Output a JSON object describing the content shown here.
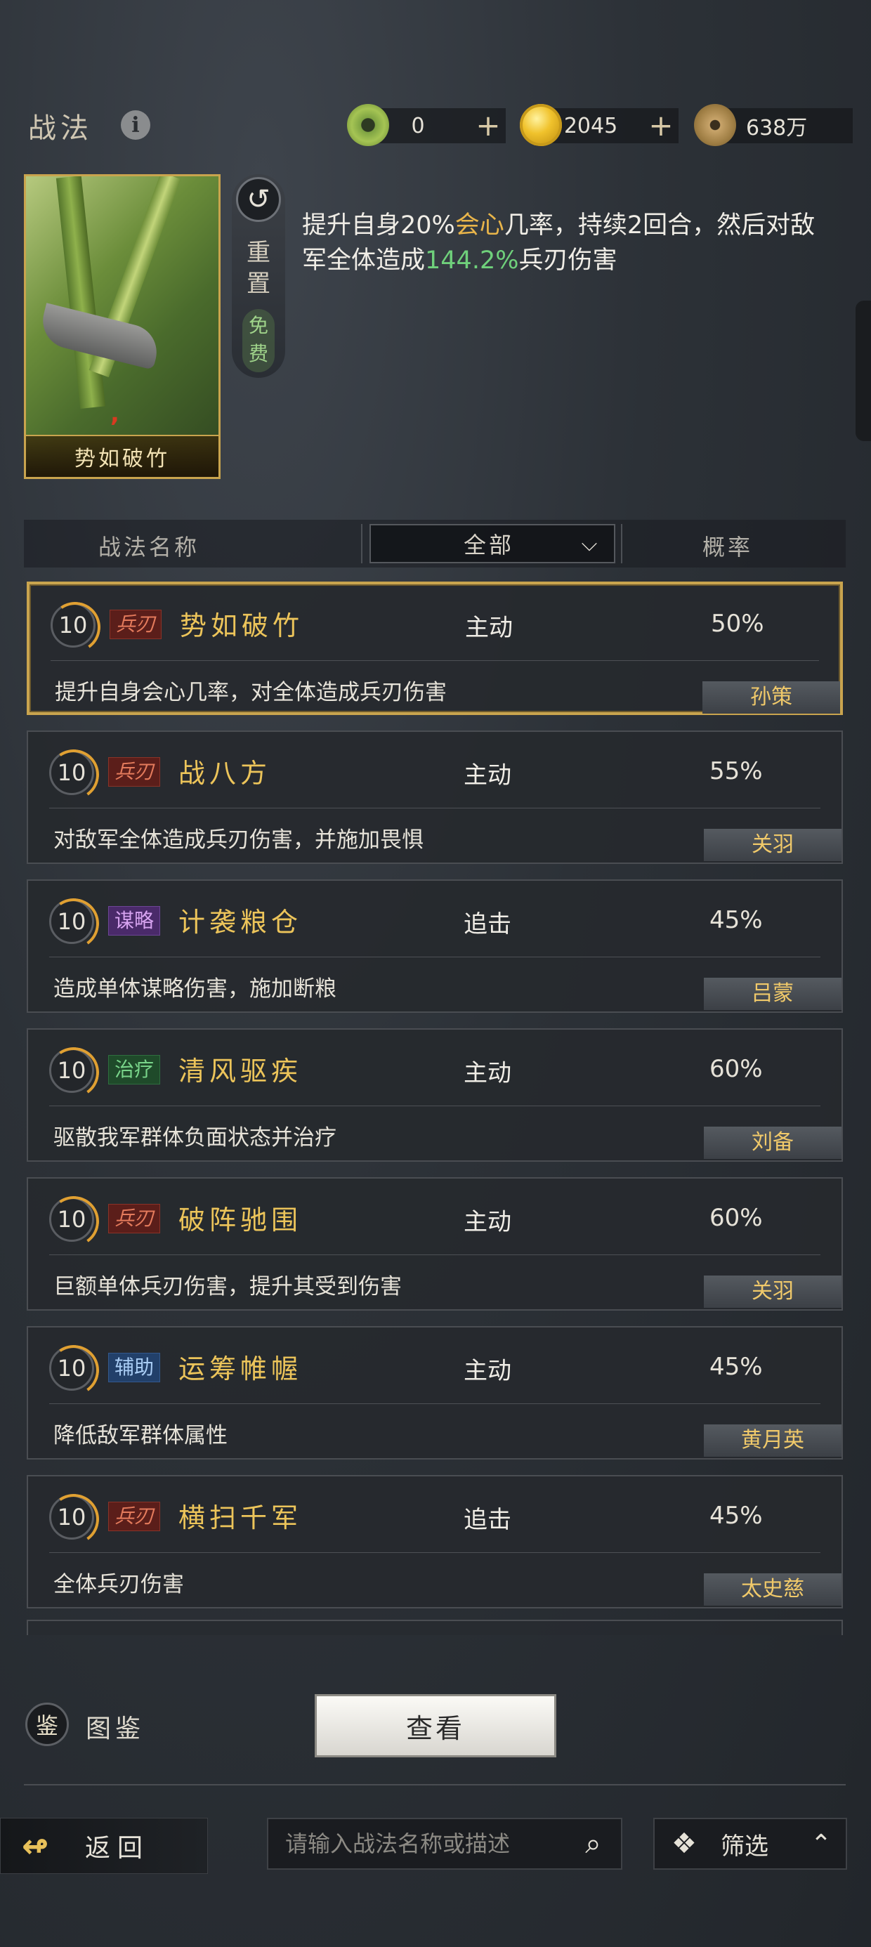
{
  "header": {
    "title": "战法",
    "info_icon": "i",
    "resources": [
      {
        "name": "jade",
        "value": "0",
        "plus": "+"
      },
      {
        "name": "gold",
        "value": "2045",
        "plus": "+"
      },
      {
        "name": "copper",
        "value": "638万"
      }
    ]
  },
  "featured": {
    "card_name": "势如破竹",
    "reset_icon": "↺",
    "reset_label": "重置",
    "free_label": "免费",
    "desc_part1": "提升自身20%",
    "desc_hl1": "会心",
    "desc_part2": "几率，持续2回合，然后对敌军全体造成",
    "desc_hl2": "144.2%",
    "desc_part3": "兵刃伤害"
  },
  "filter": {
    "col_name": "战法名称",
    "dropdown_value": "全部",
    "col_prob": "概率"
  },
  "list": [
    {
      "level": "10",
      "tag": "兵刃",
      "name": "势如破竹",
      "type": "主动",
      "prob": "50%",
      "desc": "提升自身会心几率，对全体造成兵刃伤害",
      "hero": "孙策"
    },
    {
      "level": "10",
      "tag": "兵刃",
      "name": "战八方",
      "type": "主动",
      "prob": "55%",
      "desc": "对敌军全体造成兵刃伤害，并施加畏惧",
      "hero": "关羽"
    },
    {
      "level": "10",
      "tag": "谋略",
      "name": "计袭粮仓",
      "type": "追击",
      "prob": "45%",
      "desc": "造成单体谋略伤害，施加断粮",
      "hero": "吕蒙"
    },
    {
      "level": "10",
      "tag": "治疗",
      "name": "清风驱疾",
      "type": "主动",
      "prob": "60%",
      "desc": "驱散我军群体负面状态并治疗",
      "hero": "刘备"
    },
    {
      "level": "10",
      "tag": "兵刃",
      "name": "破阵驰围",
      "type": "主动",
      "prob": "60%",
      "desc": "巨额单体兵刃伤害，提升其受到伤害",
      "hero": "关羽"
    },
    {
      "level": "10",
      "tag": "辅助",
      "name": "运筹帷幄",
      "type": "主动",
      "prob": "45%",
      "desc": "降低敌军群体属性",
      "hero": "黄月英"
    },
    {
      "level": "10",
      "tag": "兵刃",
      "name": "横扫千军",
      "type": "追击",
      "prob": "45%",
      "desc": "全体兵刃伤害",
      "hero": "太史慈"
    }
  ],
  "bottom": {
    "gallery_icon": "鉴",
    "gallery_label": "图鉴",
    "view_button": "查看",
    "back_label": "返回",
    "search_placeholder": "请输入战法名称或描述",
    "filter_label": "筛选"
  }
}
